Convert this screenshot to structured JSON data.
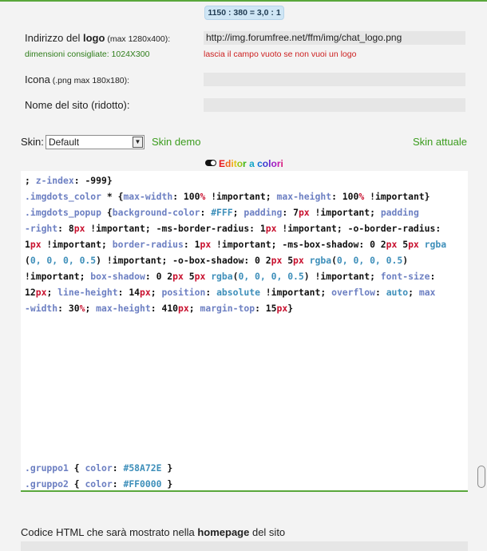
{
  "ratio_badge": "1150 : 380 = 3,0 : 1",
  "logo": {
    "label_pre": "Indirizzo del ",
    "label_bold": "logo",
    "label_small": " (max 1280x400):",
    "hint": "dimensioni consigliate: 1024X300",
    "value": "http://img.forumfree.net/ffm/img/chat_logo.png",
    "warning": "lascia il campo vuoto se non vuoi un logo"
  },
  "icon": {
    "label": "Icona",
    "label_small": " (.png max 180x180):",
    "value": ""
  },
  "site_name": {
    "label": "Nome del sito (ridotto):",
    "value": ""
  },
  "skin": {
    "label": "Skin:",
    "selected": "Default",
    "demo_link": "Skin demo",
    "current_link": "Skin attuale"
  },
  "editor_toggle": {
    "letters": [
      "E",
      "d",
      "i",
      "t",
      "o",
      "r",
      " ",
      "a",
      " ",
      "c",
      "o",
      "l",
      "o",
      "r",
      "i"
    ],
    "colors": [
      "#e8161b",
      "#f0641e",
      "#f5a50f",
      "#e1c51a",
      "#9ac412",
      "#3ab514",
      "#000000",
      "#13a5c8",
      "#000000",
      "#1470d6",
      "#3c3ad2",
      "#6d24c8",
      "#9b1ec4",
      "#c419b0",
      "#d81a7e"
    ]
  },
  "code": {
    "lines": [
      [
        [
          "p",
          "; "
        ],
        [
          "prop",
          "z-index"
        ],
        [
          "p",
          ": "
        ],
        [
          "num",
          "-999"
        ],
        [
          "p",
          "}"
        ]
      ],
      [
        [
          "sel",
          ".imgdots_color"
        ],
        [
          "p",
          " * {"
        ],
        [
          "prop",
          "max-width"
        ],
        [
          "p",
          ": "
        ],
        [
          "num",
          "100"
        ],
        [
          "unit",
          "%"
        ],
        [
          "p",
          " !important; "
        ],
        [
          "prop",
          "max-height"
        ],
        [
          "p",
          ": "
        ],
        [
          "num",
          "100"
        ],
        [
          "unit",
          "%"
        ],
        [
          "p",
          " !important}"
        ]
      ],
      [
        [
          "sel",
          ".imgdots_popup"
        ],
        [
          "p",
          " {"
        ],
        [
          "prop",
          "background-color"
        ],
        [
          "p",
          ": "
        ],
        [
          "hex",
          "#FFF"
        ],
        [
          "p",
          "; "
        ],
        [
          "prop",
          "padding"
        ],
        [
          "p",
          ": "
        ],
        [
          "num",
          "7"
        ],
        [
          "unit",
          "px"
        ],
        [
          "p",
          " !important; "
        ],
        [
          "prop",
          "padding"
        ]
      ],
      [
        [
          "prop",
          "-right"
        ],
        [
          "p",
          ": "
        ],
        [
          "num",
          "8"
        ],
        [
          "unit",
          "px"
        ],
        [
          "p",
          " !important; -ms-border-radius: "
        ],
        [
          "num",
          "1"
        ],
        [
          "unit",
          "px"
        ],
        [
          "p",
          " !important; -o-border-radius:"
        ]
      ],
      [
        [
          "num",
          "1"
        ],
        [
          "unit",
          "px"
        ],
        [
          "p",
          " !important; "
        ],
        [
          "prop",
          "border-radius"
        ],
        [
          "p",
          ": "
        ],
        [
          "num",
          "1"
        ],
        [
          "unit",
          "px"
        ],
        [
          "p",
          " !important; -ms-box-shadow: "
        ],
        [
          "num",
          "0 2"
        ],
        [
          "unit",
          "px"
        ],
        [
          "p",
          " "
        ],
        [
          "num",
          "5"
        ],
        [
          "unit",
          "px"
        ],
        [
          "p",
          " "
        ],
        [
          "fn",
          "rgba"
        ]
      ],
      [
        [
          "p",
          "("
        ],
        [
          "fn",
          "0, 0, 0, 0.5"
        ],
        [
          "p",
          ") !important; -o-box-shadow: "
        ],
        [
          "num",
          "0 2"
        ],
        [
          "unit",
          "px"
        ],
        [
          "p",
          " "
        ],
        [
          "num",
          "5"
        ],
        [
          "unit",
          "px"
        ],
        [
          "p",
          " "
        ],
        [
          "fn",
          "rgba"
        ],
        [
          "p",
          "("
        ],
        [
          "fn",
          "0, 0, 0, 0.5"
        ],
        [
          "p",
          ")"
        ]
      ],
      [
        [
          "p",
          "!important; "
        ],
        [
          "prop",
          "box-shadow"
        ],
        [
          "p",
          ": "
        ],
        [
          "num",
          "0 2"
        ],
        [
          "unit",
          "px"
        ],
        [
          "p",
          " "
        ],
        [
          "num",
          "5"
        ],
        [
          "unit",
          "px"
        ],
        [
          "p",
          " "
        ],
        [
          "fn",
          "rgba"
        ],
        [
          "p",
          "("
        ],
        [
          "fn",
          "0, 0, 0, 0.5"
        ],
        [
          "p",
          ") !important; "
        ],
        [
          "prop",
          "font-size"
        ],
        [
          "p",
          ":"
        ]
      ],
      [
        [
          "num",
          "12"
        ],
        [
          "unit",
          "px"
        ],
        [
          "p",
          "; "
        ],
        [
          "prop",
          "line-height"
        ],
        [
          "p",
          ": "
        ],
        [
          "num",
          "14"
        ],
        [
          "unit",
          "px"
        ],
        [
          "p",
          "; "
        ],
        [
          "prop",
          "position"
        ],
        [
          "p",
          ": "
        ],
        [
          "val",
          "absolute"
        ],
        [
          "p",
          " !important; "
        ],
        [
          "prop",
          "overflow"
        ],
        [
          "p",
          ": "
        ],
        [
          "val",
          "auto"
        ],
        [
          "p",
          "; "
        ],
        [
          "prop",
          "max"
        ]
      ],
      [
        [
          "prop",
          "-width"
        ],
        [
          "p",
          ": "
        ],
        [
          "num",
          "30"
        ],
        [
          "unit",
          "%"
        ],
        [
          "p",
          "; "
        ],
        [
          "prop",
          "max-height"
        ],
        [
          "p",
          ": "
        ],
        [
          "num",
          "410"
        ],
        [
          "unit",
          "px"
        ],
        [
          "p",
          "; "
        ],
        [
          "prop",
          "margin-top"
        ],
        [
          "p",
          ": "
        ],
        [
          "num",
          "15"
        ],
        [
          "unit",
          "px"
        ],
        [
          "p",
          "}"
        ]
      ]
    ],
    "bottom_lines": [
      [
        [
          "sel",
          ".gruppo1"
        ],
        [
          "p",
          " { "
        ],
        [
          "prop",
          "color"
        ],
        [
          "p",
          ": "
        ],
        [
          "hex",
          "#58A72E"
        ],
        [
          "p",
          " }"
        ]
      ],
      [
        [
          "sel",
          ".gruppo2"
        ],
        [
          "p",
          " { "
        ],
        [
          "prop",
          "color"
        ],
        [
          "p",
          ": "
        ],
        [
          "hex",
          "#FF0000"
        ],
        [
          "p",
          " }"
        ]
      ]
    ]
  },
  "homepage_html": {
    "label_pre": "Codice HTML che sarà mostrato nella ",
    "label_bold": "homepage",
    "label_post": " del sito"
  }
}
